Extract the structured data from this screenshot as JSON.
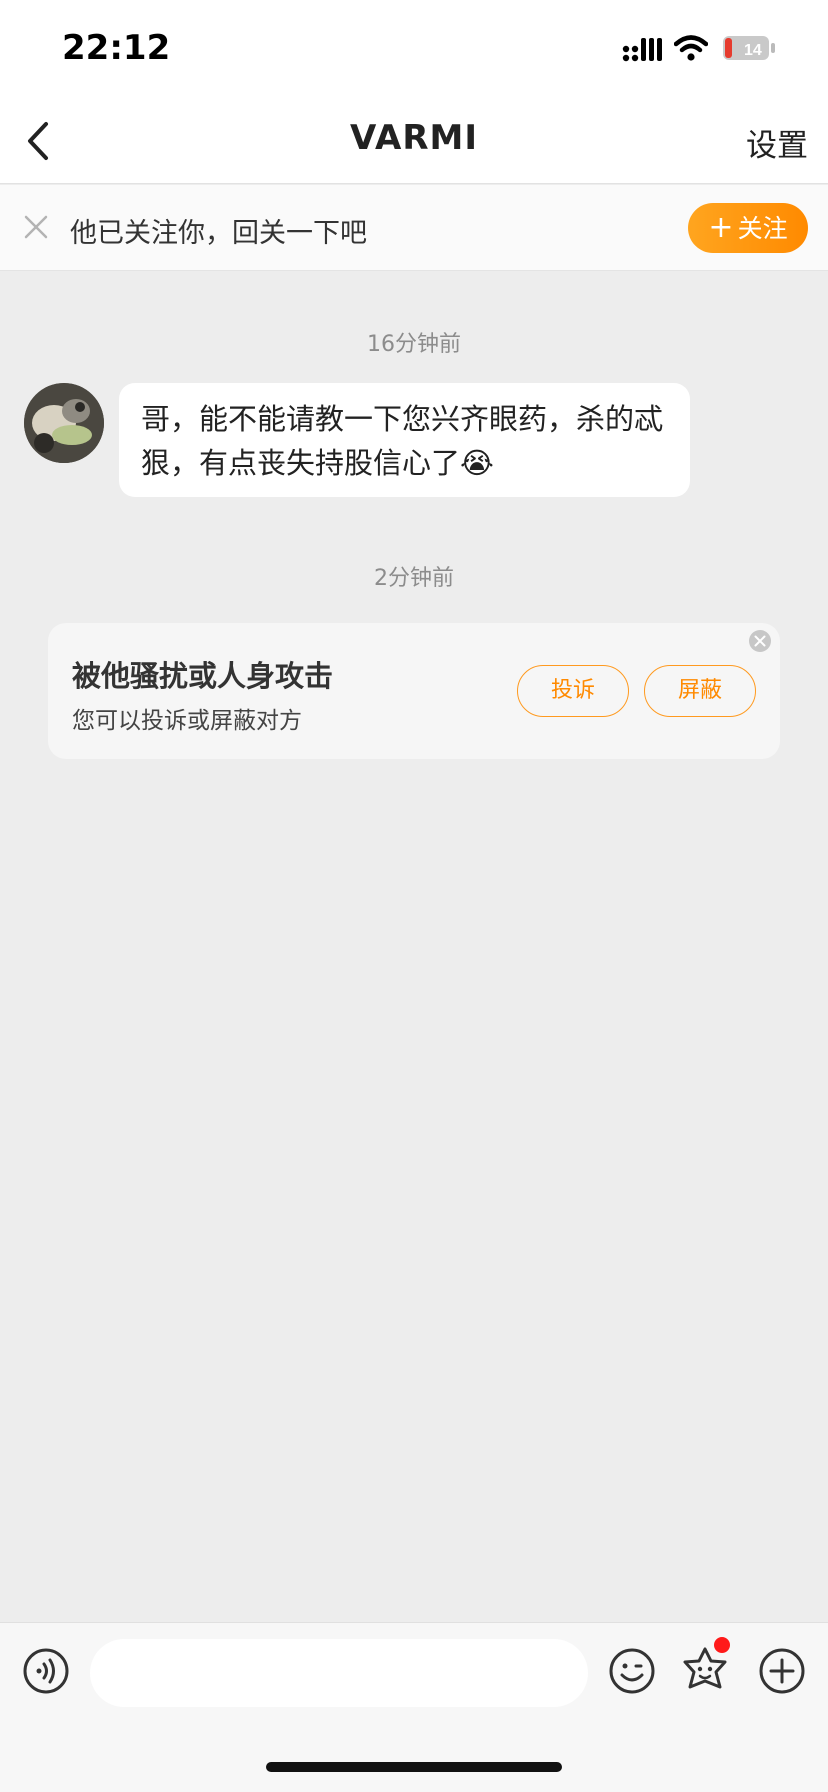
{
  "status_bar": {
    "time": "22:12",
    "battery_level": "14"
  },
  "nav": {
    "title": "VARMI",
    "settings_label": "设置"
  },
  "follow_bar": {
    "text": "他已关注你，回关一下吧",
    "button_label": "关注",
    "button_plus": "+"
  },
  "messages": [
    {
      "timestamp": "16分钟前",
      "text": "哥，能不能请教一下您兴齐眼药，杀的忒狠，有点丧失持股信心了😭"
    }
  ],
  "notice": {
    "timestamp": "2分钟前",
    "title": "被他骚扰或人身攻击",
    "subtitle": "您可以投诉或屏蔽对方",
    "report_label": "投诉",
    "block_label": "屏蔽"
  },
  "input": {
    "placeholder": ""
  },
  "colors": {
    "accent": "#ff8a00",
    "background": "#ededed",
    "notice_dot": "#ff1a1a"
  },
  "icons": [
    "back-icon",
    "signal-icon",
    "wifi-icon",
    "battery-icon",
    "close-icon",
    "voice-icon",
    "emoji-icon",
    "sticker-icon",
    "plus-circle-icon"
  ]
}
